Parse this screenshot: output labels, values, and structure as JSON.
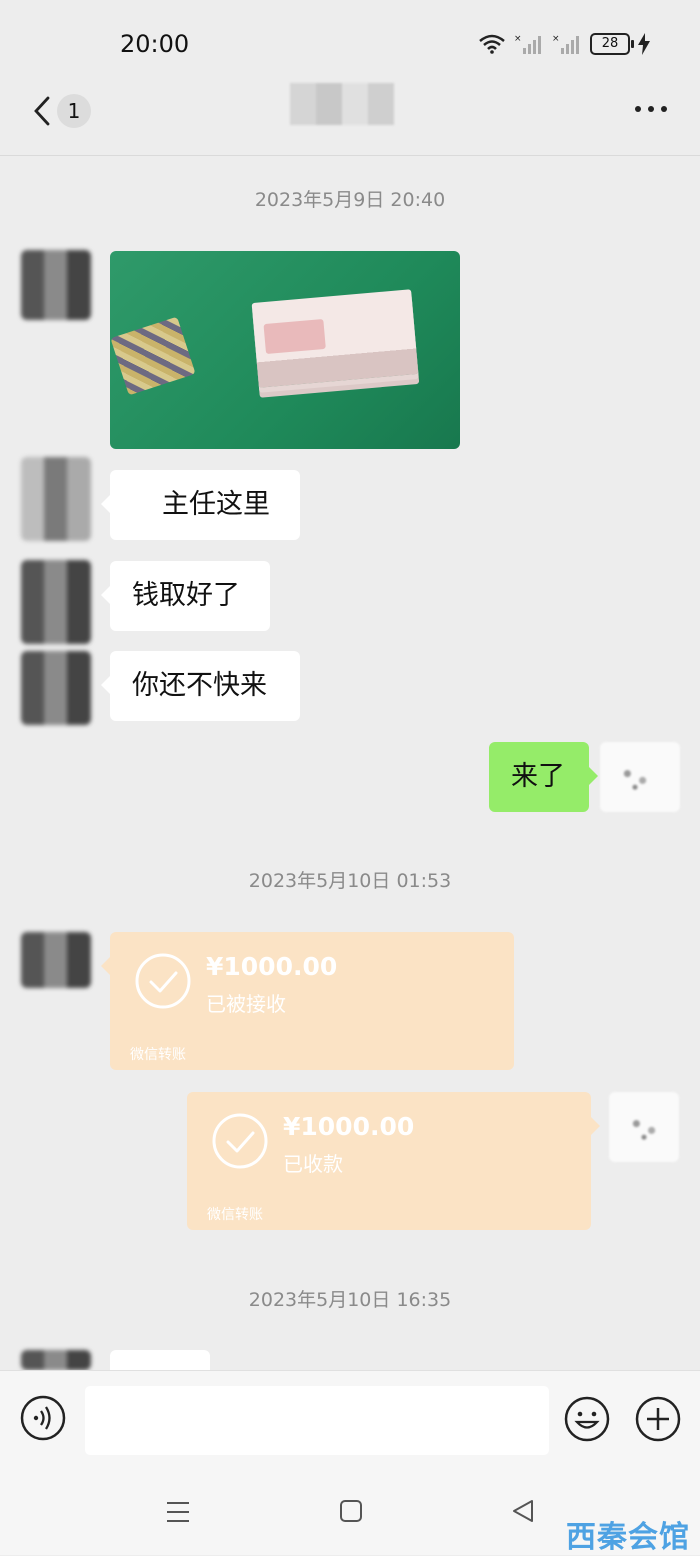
{
  "status_bar": {
    "time": "20:00",
    "battery": "28",
    "icons": [
      "wifi-icon",
      "signal-icon",
      "signal-icon",
      "battery-icon",
      "charging-icon"
    ]
  },
  "header": {
    "back_count": "1",
    "icons": [
      "back-icon",
      "more-icon"
    ]
  },
  "timestamps": [
    "2023年5月9日 20:40",
    "2023年5月10日 01:53",
    "2023年5月10日 16:35"
  ],
  "messages": [
    {
      "type": "image",
      "from": "other"
    },
    {
      "type": "text",
      "from": "other",
      "text": "主任这里"
    },
    {
      "type": "text",
      "from": "other",
      "text": "钱取好了"
    },
    {
      "type": "text",
      "from": "other",
      "text": "你还不快来"
    },
    {
      "type": "text",
      "from": "self",
      "text": "来了"
    },
    {
      "type": "transfer",
      "from": "other",
      "amount": "¥1000.00",
      "status": "已被接收",
      "label": "微信转账"
    },
    {
      "type": "transfer",
      "from": "self",
      "amount": "¥1000.00",
      "status": "已收款",
      "label": "微信转账"
    }
  ],
  "input_bar": {
    "icons": [
      "voice-icon",
      "emoji-icon",
      "plus-icon"
    ]
  },
  "nav_bar": {
    "icons": [
      "menu-icon",
      "home-icon",
      "back-triangle-icon"
    ]
  },
  "watermark": "西秦会馆",
  "colors": {
    "background": "#ededed",
    "self_bubble": "#95ec69",
    "transfer_card": "#fbe3c5",
    "watermark": "#4ea2e3"
  }
}
